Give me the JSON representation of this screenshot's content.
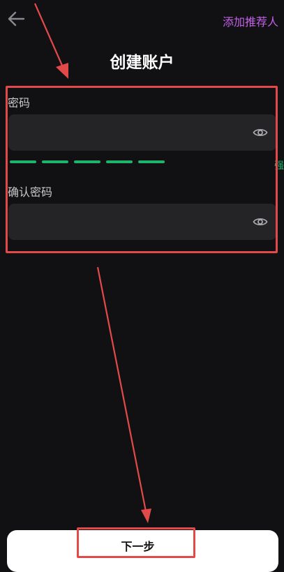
{
  "header": {
    "back_icon": "arrow-left-icon",
    "add_referrer_label": "添加推荐人",
    "title": "创建账户"
  },
  "form": {
    "password": {
      "label": "密码",
      "value": "",
      "placeholder": "",
      "visibility_icon": "eye-icon"
    },
    "strength": {
      "segments_total": 5,
      "segments_filled": 5,
      "label": "强",
      "color": "#1fb36b"
    },
    "confirm_password": {
      "label": "确认密码",
      "value": "",
      "placeholder": "",
      "visibility_icon": "eye-icon"
    }
  },
  "footer": {
    "next_label": "下一步"
  },
  "colors": {
    "background": "#111114",
    "accent_purple": "#c261e8",
    "input_bg": "#242427",
    "annotation_red": "#e24a4a"
  }
}
